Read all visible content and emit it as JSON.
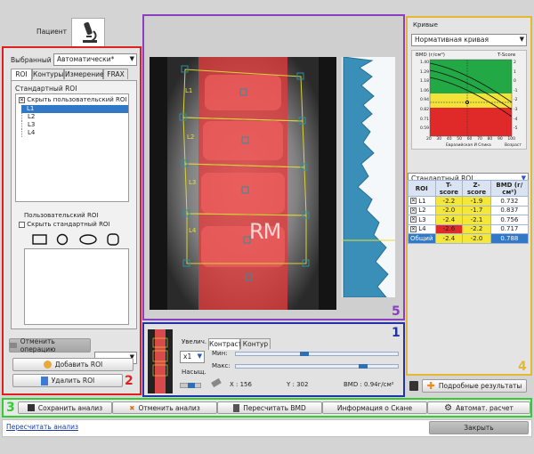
{
  "patient_tab": "Пациент",
  "left": {
    "selected_label": "Выбранный",
    "selected_value": "Автоматически*",
    "tabs": [
      "ROI",
      "Контуры",
      "Измерение",
      "FRAX"
    ],
    "std_roi_group": "Стандартный ROI",
    "hide_user_roi": "Скрыть пользовательский ROI",
    "roi_items": [
      "L1",
      "L2",
      "L3",
      "L4"
    ],
    "user_roi_group": "Пользовательский ROI",
    "hide_std_roi": "Скрыть стандартный ROI",
    "undo_button": "Отменить операцию",
    "add_roi": "Добавить ROI",
    "delete_roi": "Удалить ROI",
    "number": "2"
  },
  "image": {
    "vertebra_labels": [
      "L1",
      "L2",
      "L3",
      "L4"
    ],
    "watermark": "RM",
    "number": "5"
  },
  "controls": {
    "zoom_label": "Увелич.",
    "zoom_value": "x1",
    "sat_label": "Насыщ.",
    "tabs": [
      "Контраст",
      "Контур"
    ],
    "min_label": "Мин:",
    "max_label": "Макс:",
    "x_readout": "X : 156",
    "y_readout": "Y : 302",
    "bmd_readout": "BMD : 0.94г/см²",
    "number": "1"
  },
  "right": {
    "curves_label": "Кривые",
    "curve_select": "Нормативная кривая",
    "chart_bmd_label": "BMD (г/см²)",
    "chart_tscore_label": "T-Score",
    "chart_y_ticks": [
      "1.40",
      "1.29",
      "1.18",
      "1.06",
      "0.94",
      "0.82",
      "0.71",
      "0.59"
    ],
    "chart_t_ticks": [
      "2",
      "1",
      "0",
      "-1",
      "-2",
      "-3",
      "-4",
      "-5"
    ],
    "chart_x_ticks": [
      "20",
      "30",
      "40",
      "50",
      "60",
      "70",
      "80",
      "90",
      "100"
    ],
    "chart_x_label": "Возраст",
    "chart_ref_label": "Евразийская И Спика",
    "roi_select": "Стандартный ROI",
    "table_headers": [
      "ROI",
      "T-score",
      "Z-score",
      "BMD (г/см²)"
    ],
    "table_rows": [
      {
        "roi": "L1",
        "t": "-2.2",
        "z": "-1.9",
        "bmd": "0.732"
      },
      {
        "roi": "L2",
        "t": "-2.0",
        "z": "-1.7",
        "bmd": "0.837"
      },
      {
        "roi": "L3",
        "t": "-2.4",
        "z": "-2.1",
        "bmd": "0.756"
      },
      {
        "roi": "L4",
        "t": "-2.6",
        "z": "-2.2",
        "bmd": "0.717"
      },
      {
        "roi": "Общий",
        "t": "-2.4",
        "z": "-2.0",
        "bmd": "0.788"
      }
    ],
    "details_button": "Подробные результаты",
    "number": "4"
  },
  "bottom": {
    "number": "3",
    "buttons": [
      "Сохранить анализ",
      "Отменить анализ",
      "Пересчитать BMD",
      "Информация о Скане",
      "Автомат. расчет"
    ],
    "recalc_link": "Пересчитать анализ",
    "close_button": "Закрыть"
  },
  "colors": {
    "red": "#e02020",
    "purple": "#8a3fc0",
    "blue": "#2233aa",
    "yellow": "#e6b830",
    "green": "#33cc33"
  }
}
